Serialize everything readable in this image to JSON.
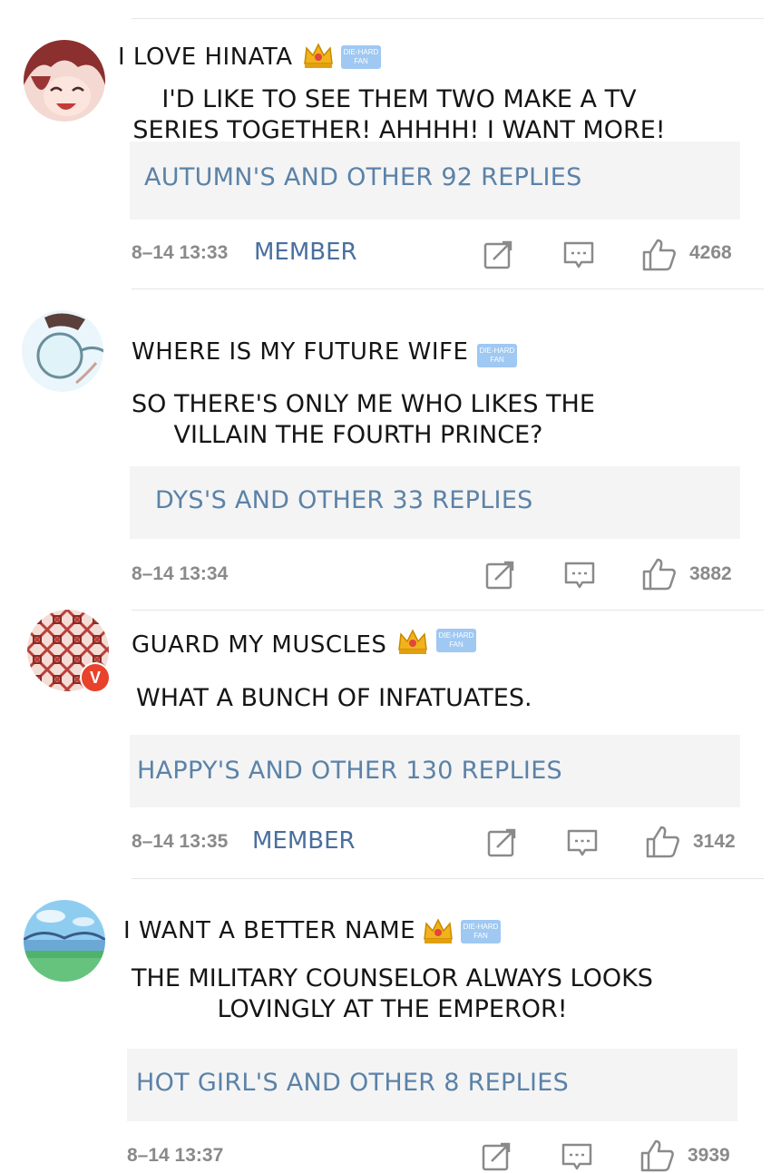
{
  "badge": {
    "line1": "DIE-HARD",
    "line2": "FAN"
  },
  "comments": [
    {
      "username": "I LOVE HINATA",
      "text_line1": "I'D LIKE TO SEE THEM TWO MAKE A TV",
      "text_line2": "SERIES TOGETHER! AHHHH! I WANT MORE!",
      "replies": "AUTUMN'S AND OTHER 92 REPLIES",
      "time": "8–14 13:33",
      "member": "MEMBER",
      "likes": "4268"
    },
    {
      "username": "WHERE IS MY FUTURE WIFE",
      "text_line1": "SO THERE'S ONLY ME WHO LIKES THE",
      "text_line2": "VILLAIN THE FOURTH PRINCE?",
      "replies": "DYS'S AND OTHER 33 REPLIES",
      "time": "8–14 13:34",
      "member": "",
      "likes": "3882"
    },
    {
      "username": "GUARD MY MUSCLES",
      "text_line1": "WHAT A BUNCH OF INFATUATES.",
      "text_line2": "",
      "replies": "HAPPY'S AND OTHER 130 REPLIES",
      "time": "8–14 13:35",
      "member": "MEMBER",
      "likes": "3142",
      "verified_mark": "V"
    },
    {
      "username": "I WANT A BETTER NAME",
      "text_line1": "THE MILITARY COUNSELOR ALWAYS LOOKS",
      "text_line2": "LOVINGLY AT THE EMPEROR!",
      "replies": "HOT GIRL'S AND OTHER 8 REPLIES",
      "time": "8–14 13:37",
      "member": "",
      "likes": "3939"
    }
  ],
  "icons": {
    "edit": "edit-icon",
    "comment": "comment-icon",
    "like": "thumbs-up-icon",
    "crown": "crown-icon"
  },
  "colors": {
    "reply_text": "#5b82a8",
    "member": "#4a6f9d",
    "badge": "#9fc8f2",
    "meta": "#8a8a8a",
    "reply_bg": "#f4f4f4"
  }
}
